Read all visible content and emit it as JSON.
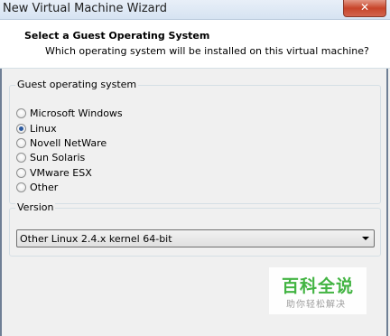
{
  "window": {
    "title": "New Virtual Machine Wizard",
    "close_glyph": "✕"
  },
  "header": {
    "title": "Select a Guest Operating System",
    "subtitle": "Which operating system will be installed on this virtual machine?"
  },
  "guest_os": {
    "label": "Guest operating system",
    "options": [
      {
        "label": "Microsoft Windows",
        "checked": false
      },
      {
        "label": "Linux",
        "checked": true
      },
      {
        "label": "Novell NetWare",
        "checked": false
      },
      {
        "label": "Sun Solaris",
        "checked": false
      },
      {
        "label": "VMware ESX",
        "checked": false
      },
      {
        "label": "Other",
        "checked": false
      }
    ]
  },
  "version": {
    "label": "Version",
    "selected": "Other Linux 2.4.x kernel 64-bit"
  },
  "watermark": {
    "main": "百科全说",
    "sub": "助你轻松解决"
  }
}
